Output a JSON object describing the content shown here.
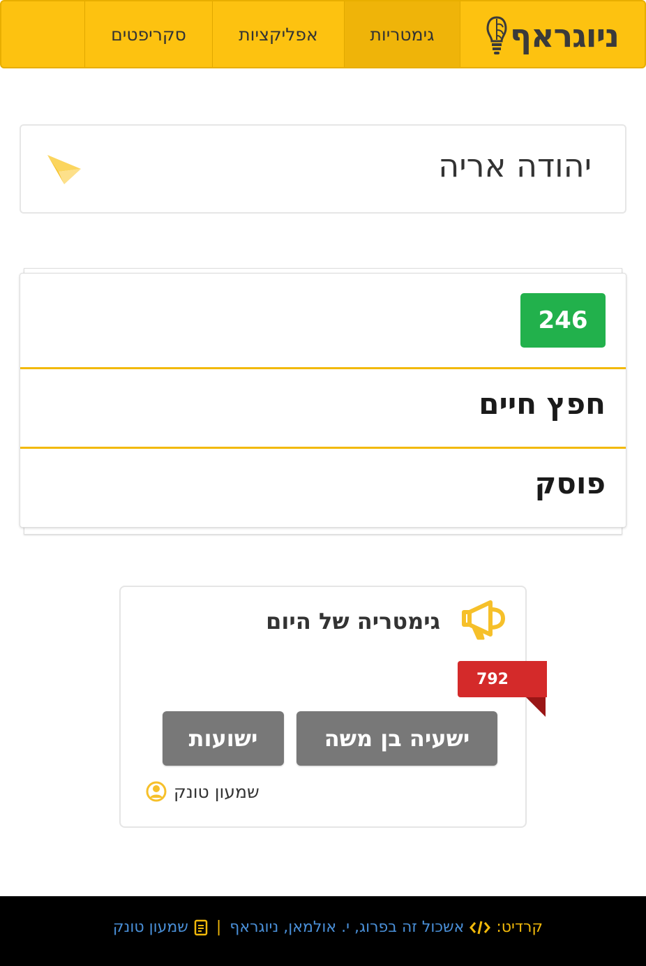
{
  "navbar": {
    "brand": "ניוגראף",
    "items": [
      {
        "label": "גימטריות",
        "active": true
      },
      {
        "label": "אפליקציות",
        "active": false
      },
      {
        "label": "סקריפטים",
        "active": false
      }
    ]
  },
  "search": {
    "value": "יהודה אריה",
    "send_icon": "paper-plane-icon"
  },
  "result": {
    "value": "246",
    "words": [
      "חפץ חיים",
      "פוסק"
    ]
  },
  "daily": {
    "title": "גימטריה של היום",
    "icon": "megaphone-icon",
    "value": "792",
    "buttons": [
      "ישעיה בן משה",
      "ישועות"
    ],
    "author": "שמעון טונק"
  },
  "footer": {
    "credit_label": "קרדיט:",
    "credit_names": "אשכול זה בפרוג, י. אולמאן, ניוגראף",
    "separator": "|",
    "author": "שמעון טונק"
  },
  "colors": {
    "brand_yellow": "#fdc210",
    "badge_green": "#22b14c",
    "ribbon_red": "#d42a2a",
    "button_gray": "#787878",
    "link_blue": "#4a90d9"
  }
}
